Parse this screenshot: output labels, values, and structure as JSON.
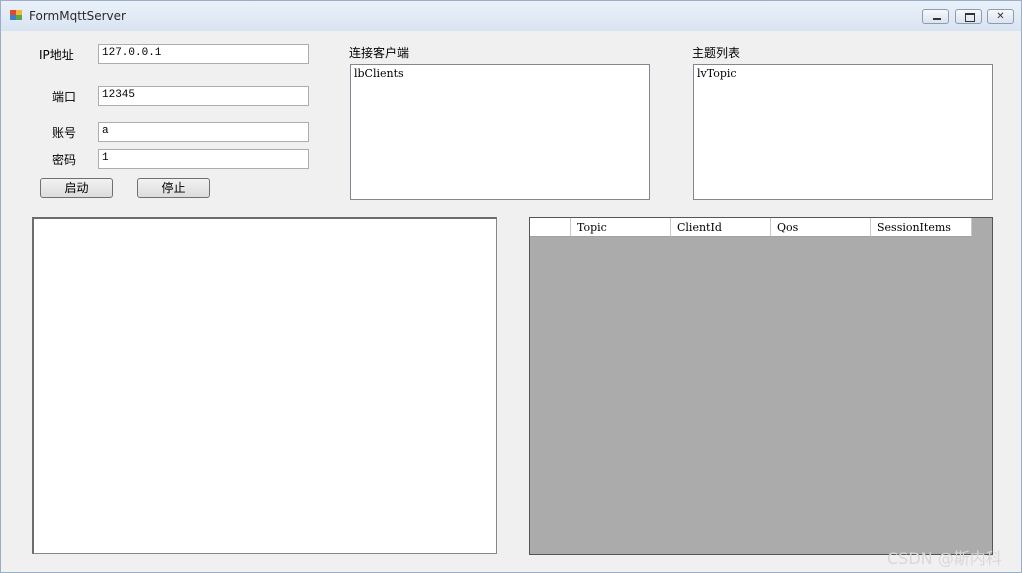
{
  "window": {
    "title": "FormMqttServer"
  },
  "form": {
    "ip_label": "IP地址",
    "ip_value": "127.0.0.1",
    "port_label": "端口",
    "port_value": "12345",
    "account_label": "账号",
    "account_value": "a",
    "password_label": "密码",
    "password_value": "1",
    "start_button": "启动",
    "stop_button": "停止"
  },
  "clients": {
    "label": "连接客户端",
    "list_name": "lbClients"
  },
  "topics": {
    "label": "主题列表",
    "list_name": "lvTopic"
  },
  "grid": {
    "columns": [
      "Topic",
      "ClientId",
      "Qos",
      "SessionItems"
    ]
  },
  "watermark": "CSDN @斯内科"
}
